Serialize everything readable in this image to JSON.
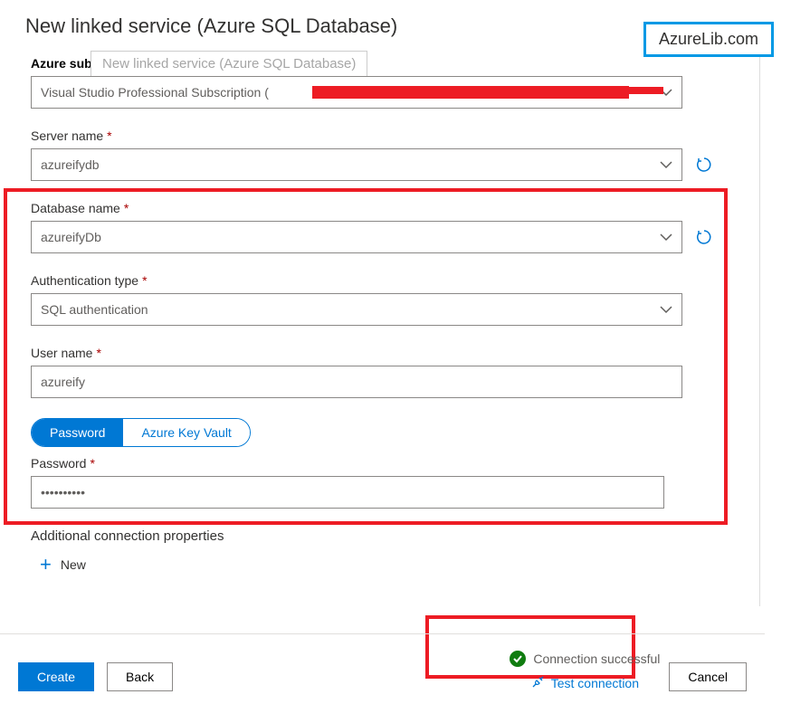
{
  "page_title": "New linked service (Azure SQL Database)",
  "ghost_title": "New linked service (Azure SQL Database)",
  "watermark": "AzureLib.com",
  "fields": {
    "subscription": {
      "label": "Azure subscription",
      "value": "Visual Studio Professional Subscription ("
    },
    "server": {
      "label": "Server name",
      "value": "azureifydb"
    },
    "database": {
      "label": "Database name",
      "value": "azureifyDb"
    },
    "auth_type": {
      "label": "Authentication type",
      "value": "SQL authentication"
    },
    "username": {
      "label": "User name",
      "value": "azureify"
    },
    "password_label": "Password",
    "password_value": "••••••••••"
  },
  "password_tabs": {
    "password": "Password",
    "keyvault": "Azure Key Vault"
  },
  "additional_section": "Additional connection properties",
  "new_button": "New",
  "status": {
    "success": "Connection successful",
    "test": "Test connection"
  },
  "buttons": {
    "create": "Create",
    "back": "Back",
    "cancel": "Cancel"
  }
}
